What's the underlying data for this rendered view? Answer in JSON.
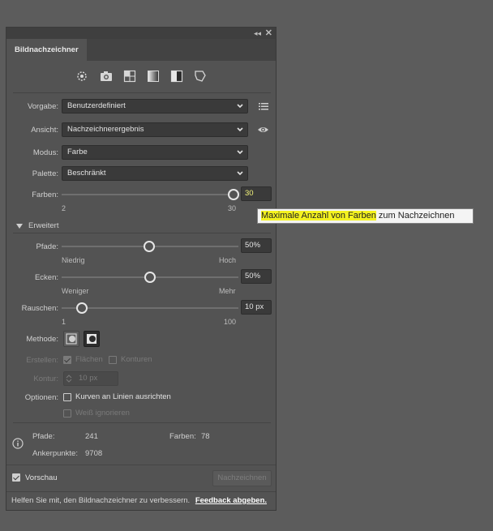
{
  "panel": {
    "tab_title": "Bildnachzeichner",
    "collapse_glyph": "◂◂",
    "close_glyph": "✕"
  },
  "presets": [
    "auto-color-icon",
    "high-fidelity-photo-icon",
    "low-fidelity-photo-icon",
    "grayscale-icon",
    "black-white-icon",
    "outline-icon"
  ],
  "vorgabe": {
    "label": "Vorgabe:",
    "value": "Benutzerdefiniert"
  },
  "ansicht": {
    "label": "Ansicht:",
    "value": "Nachzeichnerergebnis"
  },
  "modus": {
    "label": "Modus:",
    "value": "Farbe"
  },
  "palette": {
    "label": "Palette:",
    "value": "Beschränkt"
  },
  "farben": {
    "label": "Farben:",
    "value": "30",
    "min": "2",
    "max": "30",
    "fraction": 1.0
  },
  "tooltip": {
    "highlight": "Maximale Anzahl von Farben",
    "rest": " zum Nachzeichnen"
  },
  "advanced": {
    "label": "Erweitert"
  },
  "pfade": {
    "label": "Pfade:",
    "value": "50%",
    "min_label": "Niedrig",
    "max_label": "Hoch",
    "fraction": 0.5
  },
  "ecken": {
    "label": "Ecken:",
    "value": "50%",
    "min_label": "Weniger",
    "max_label": "Mehr",
    "fraction": 0.5
  },
  "rauschen": {
    "label": "Rauschen:",
    "value": "10 px",
    "min": "1",
    "max": "100",
    "fraction": 0.1
  },
  "methode": {
    "label": "Methode:"
  },
  "erstellen": {
    "label": "Erstellen:",
    "flaechen": "Flächen",
    "konturen": "Konturen"
  },
  "kontur": {
    "label": "Kontur:",
    "value": "10 px"
  },
  "optionen": {
    "label": "Optionen:",
    "kurven": "Kurven an Linien ausrichten",
    "weiss": "Weiß ignorieren"
  },
  "info": {
    "pfade_label": "Pfade:",
    "pfade_value": "241",
    "farben_label": "Farben:",
    "farben_value": "78",
    "anker_label": "Ankerpunkte:",
    "anker_value": "9708"
  },
  "vorschau": {
    "label": "Vorschau"
  },
  "trace_button": "Nachzeichnen",
  "footer": {
    "text": "Helfen Sie mit, den Bildnachzeichner zu verbessern.",
    "link": "Feedback abgeben."
  }
}
